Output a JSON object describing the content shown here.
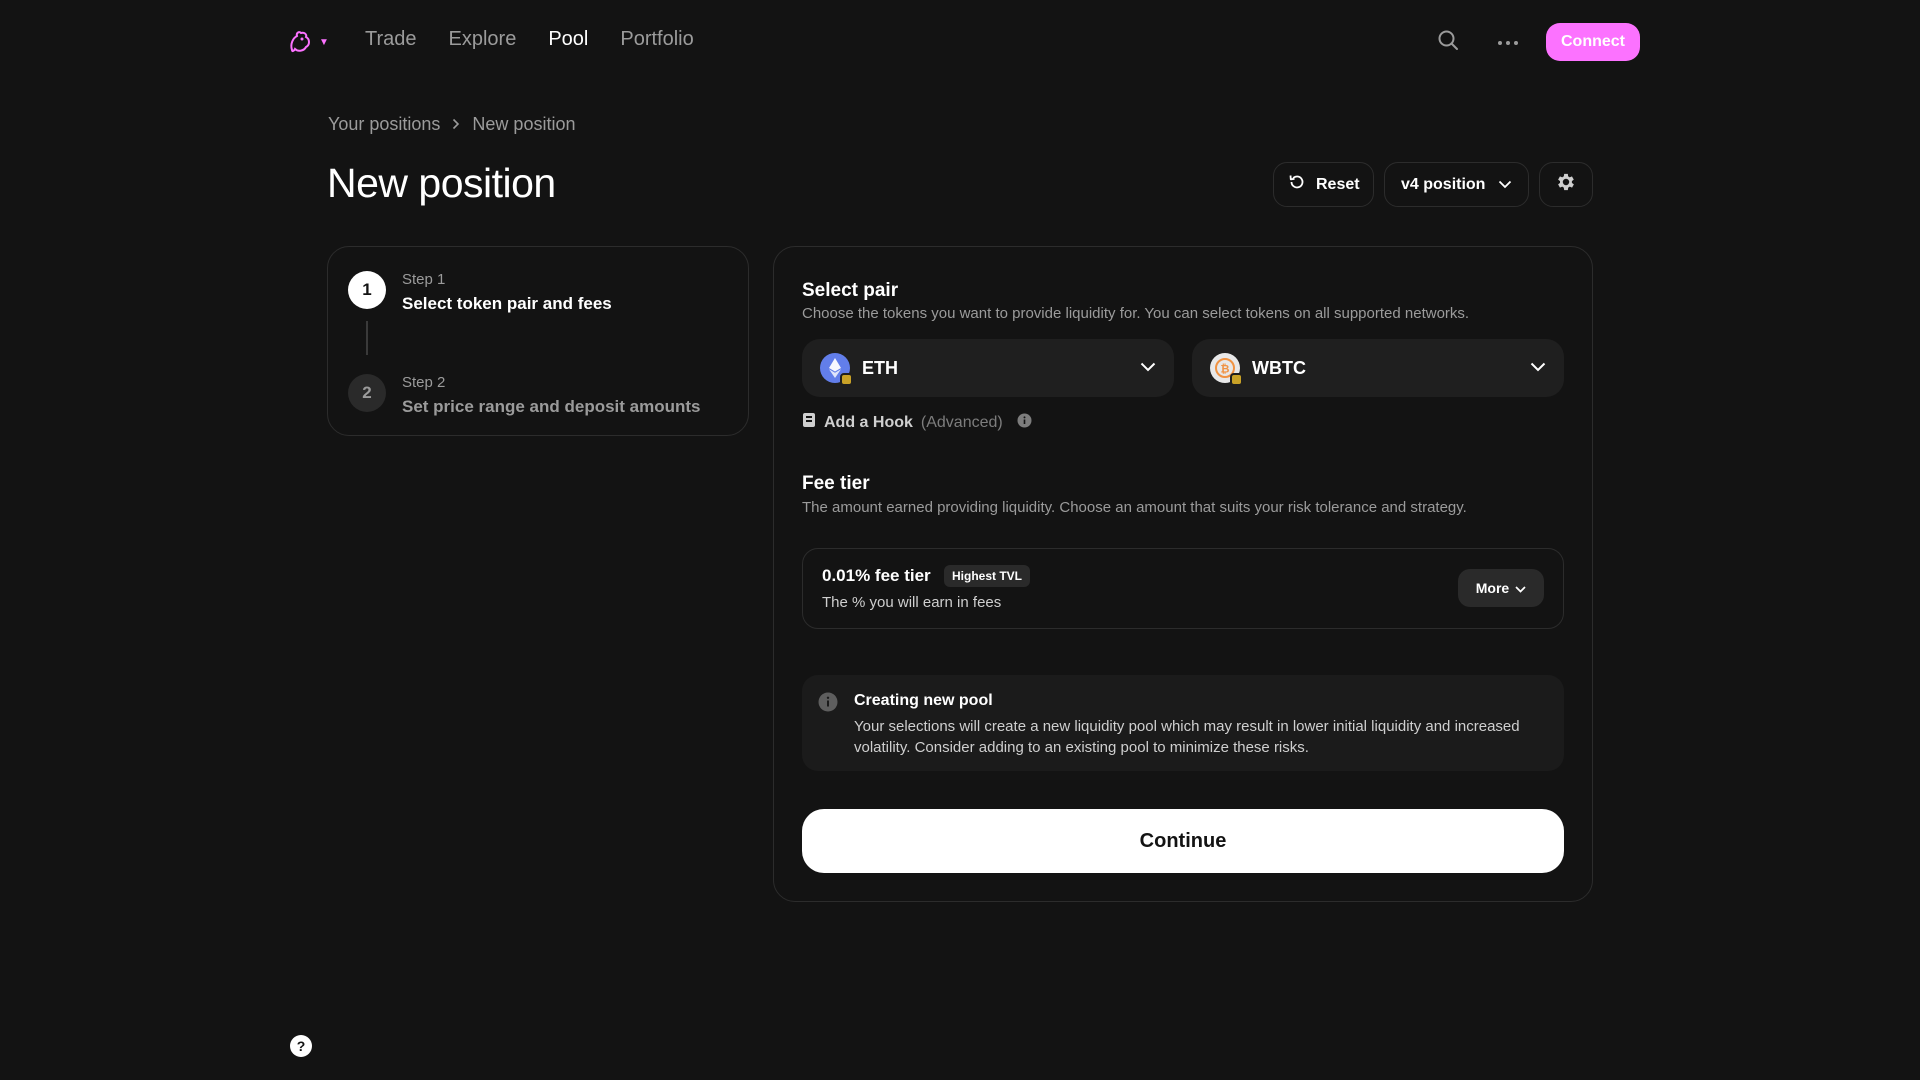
{
  "nav": {
    "links": [
      {
        "label": "Trade",
        "active": false
      },
      {
        "label": "Explore",
        "active": false
      },
      {
        "label": "Pool",
        "active": true
      },
      {
        "label": "Portfolio",
        "active": false
      }
    ],
    "connect_label": "Connect",
    "icons": {
      "logo": "uniswap-unicorn-icon",
      "search": "search-icon",
      "more": "more-dots-icon"
    }
  },
  "breadcrumb": {
    "parent": "Your positions",
    "current": "New position"
  },
  "header": {
    "title": "New position",
    "reset_label": "Reset",
    "version_label": "v4 position"
  },
  "steps": [
    {
      "number": "1",
      "label": "Step 1",
      "title": "Select token pair and fees"
    },
    {
      "number": "2",
      "label": "Step 2",
      "title": "Set price range and deposit amounts"
    }
  ],
  "select_pair": {
    "title": "Select pair",
    "description": "Choose the tokens you want to provide liquidity for. You can select tokens on all supported networks.",
    "token_a": "ETH",
    "token_b": "WBTC",
    "hook_label": "Add a Hook",
    "hook_advanced": "(Advanced)"
  },
  "fee_tier": {
    "title": "Fee tier",
    "description": "The amount earned providing liquidity. Choose an amount that suits your risk tolerance and strategy.",
    "selected": "0.01% fee tier",
    "badge": "Highest TVL",
    "sub": "The % you will earn in fees",
    "more_label": "More"
  },
  "notice": {
    "title": "Creating new pool",
    "text": "Your selections will create a new liquidity pool which may result in lower initial liquidity and increased volatility. Consider adding to an existing pool to minimize these risks."
  },
  "continue_label": "Continue",
  "help_label": "?",
  "colors": {
    "accent": "#fc72ff",
    "background": "#131313",
    "surface": "#1f1f1f",
    "border": "#2c2c2c"
  }
}
